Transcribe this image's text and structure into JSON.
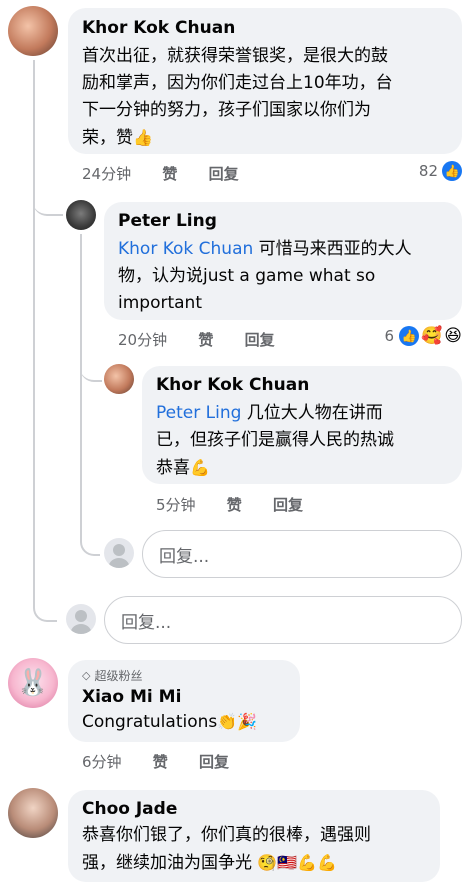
{
  "comments": [
    {
      "author": "Khor Kok Chuan",
      "text": "首次出征，就获得荣誉银奖，是很大的鼓励和掌声，因为你们走过台上10年功，台下一分钟的努力，孩子们国家以你们为荣，赞",
      "lines": [
        "首次出征，就获得荣誉银奖，是很大的鼓",
        "励和掌声，因为你们走过台上10年功，台",
        "下一分钟的努力，孩子们国家以你们为",
        "荣，赞"
      ],
      "emoji": "👍",
      "time": "24分钟",
      "like": "赞",
      "reply": "回复",
      "reactions": "82",
      "replies": [
        {
          "author": "Peter Ling",
          "mention": "Khor Kok Chuan",
          "lines": [
            " 可惜马来西亚的大人",
            "物，认为说just a game what so",
            "important"
          ],
          "time": "20分钟",
          "like": "赞",
          "reply": "回复",
          "reactions": "6",
          "replies": [
            {
              "author": "Khor Kok Chuan",
              "mention": "Peter Ling",
              "lines": [
                " 几位大人物在讲而",
                "已，但孩子们是赢得人民的热诚",
                "恭喜"
              ],
              "emoji": "💪",
              "time": "5分钟",
              "like": "赞",
              "reply": "回复"
            }
          ],
          "reply_placeholder": "回复..."
        }
      ],
      "reply_placeholder": "回复..."
    },
    {
      "badge": "超级粉丝",
      "author": "Xiao Mi Mi",
      "text": "Congratulations",
      "emoji": "👏🎉",
      "time": "6分钟",
      "like": "赞",
      "reply": "回复"
    },
    {
      "author": "Choo Jade",
      "lines": [
        "恭喜你们银了，你们真的很棒，遇强则",
        "强，继续加油为国争光"
      ],
      "emoji": "🧐🇲🇾💪💪"
    }
  ],
  "colors": {
    "bubble": "#f0f2f5",
    "mention": "#216fdb",
    "meta": "#65676b",
    "like_blue": "#1877f2"
  }
}
